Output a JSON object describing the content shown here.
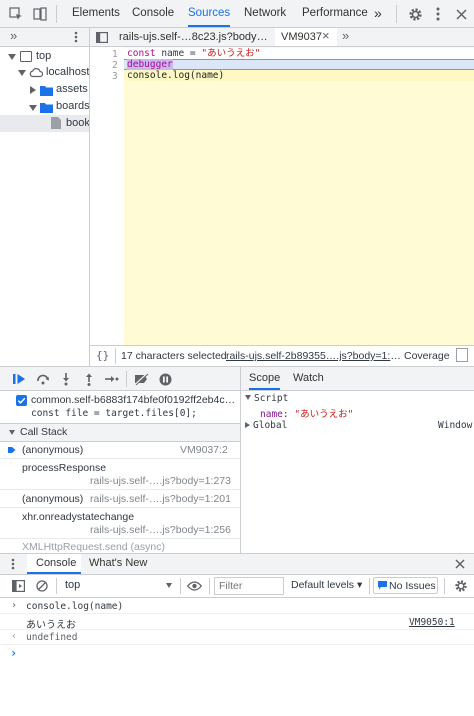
{
  "main_tabs": [
    "Elements",
    "Console",
    "Sources",
    "Network",
    "Performance"
  ],
  "overflow_glyph": "»",
  "navigator": {
    "tree": [
      {
        "label": "top",
        "icon": "frame-icon"
      },
      {
        "label": "localhost:",
        "icon": "cloud-icon"
      },
      {
        "label": "assets",
        "icon": "folder-icon"
      },
      {
        "label": "boards",
        "icon": "folder-icon"
      },
      {
        "label": "book",
        "icon": "file-icon"
      }
    ]
  },
  "editor": {
    "tabs": [
      {
        "label": "rails-ujs.self-…8c23.js?body=1"
      },
      {
        "label": "VM9037",
        "close": "×"
      }
    ],
    "line_numbers": [
      "1",
      "2",
      "3"
    ],
    "code": {
      "l1_kw": "const",
      "l1_mid": " name = ",
      "l1_str": "\"あいうえお\"",
      "l2": "debugger",
      "l3": "console.log(name)"
    },
    "status": {
      "braces": "{}",
      "selected": "17 characters selected",
      "source_link": "rails-ujs.self-2b89355….js?body=1:273",
      "coverage": "Coverage"
    }
  },
  "debugger": {
    "breakpoint_file": "common.self-b6883f174bfe0f0192ff2eb4cb…",
    "breakpoint_code": "const file = target.files[0];",
    "call_stack_title": "Call Stack",
    "frames": [
      {
        "name": "(anonymous)",
        "location": "VM9037:2"
      },
      {
        "name": "processResponse",
        "location": "rails-ujs.self-….js?body=1:273"
      },
      {
        "name": "(anonymous)",
        "location": "rails-ujs.self-….js?body=1:201"
      },
      {
        "name": "xhr.onreadystatechange",
        "location": "rails-ujs.self-….js?body=1:256"
      }
    ],
    "async_label": "XMLHttpRequest.send (async)"
  },
  "scope": {
    "tabs": [
      "Scope",
      "Watch"
    ],
    "script_label": "Script",
    "var_name": "name",
    "var_value": "\"あいうえお\"",
    "global_label": "Global",
    "global_value": "Window"
  },
  "console": {
    "tabs": [
      "Console",
      "What's New"
    ],
    "context": "top",
    "filter_placeholder": "Filter",
    "levels": "Default levels ▾",
    "issues": "No Issues",
    "lines": {
      "input": "console.log(name)",
      "output": "あいうえお",
      "output_link": "VM9050:1",
      "result": "undefined"
    },
    "prompt_glyph": "›",
    "input_glyph": "›",
    "result_glyph": "‹"
  },
  "colors": {
    "accent": "#1a73e8",
    "highlight": "#fffbd4",
    "paused_line": "#fef9c3"
  }
}
